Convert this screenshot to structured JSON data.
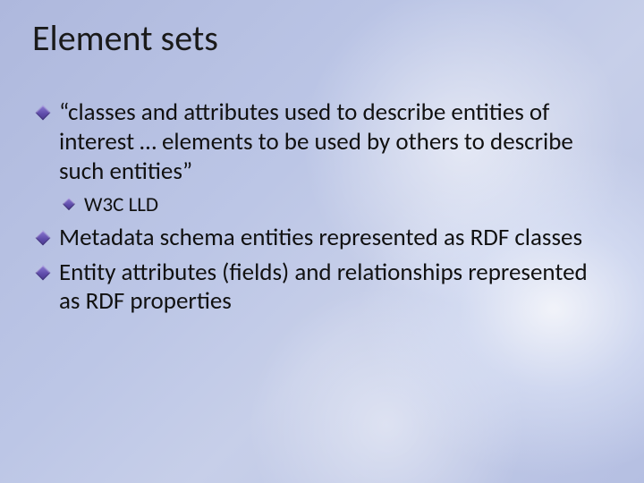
{
  "slide": {
    "title": "Element sets",
    "bullets": [
      {
        "level": 1,
        "text": "“classes and attributes used to describe entities of interest … elements to be used by others to describe such entities”"
      },
      {
        "level": 2,
        "text": "W3C LLD"
      },
      {
        "level": 1,
        "text": "Metadata schema entities represented as RDF classes"
      },
      {
        "level": 1,
        "text": "Entity attributes (fields) and relationships represented as RDF properties"
      }
    ]
  }
}
